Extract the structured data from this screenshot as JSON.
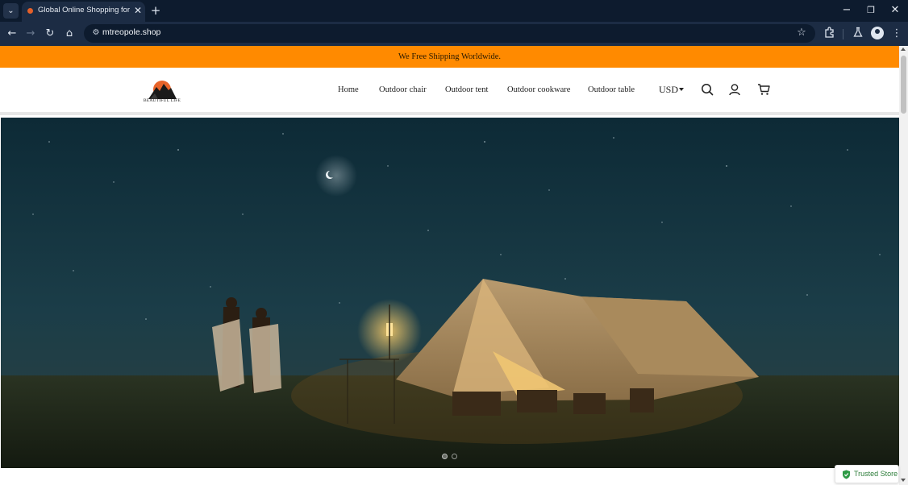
{
  "browser": {
    "tab_menu_icon": "chevron-down",
    "tab": {
      "title": "Global Online Shopping for ,AU",
      "close_glyph": "✕"
    },
    "new_tab_glyph": "+",
    "window": {
      "minimize": "−",
      "restore": "❐",
      "close": "✕"
    },
    "toolbar": {
      "back": "←",
      "forward": "→",
      "reload": "↻",
      "home": "⌂",
      "url": "mtreopole.shop",
      "star": "☆"
    }
  },
  "page": {
    "announcement": "We Free Shipping Worldwide.",
    "logo_text": "BEAUTIFUL LIFE",
    "nav": [
      "Home",
      "Outdoor chair",
      "Outdoor tent",
      "Outdoor cookware",
      "Outdoor table"
    ],
    "currency": "USD",
    "header_icons": [
      "search-icon",
      "account-icon",
      "cart-icon"
    ],
    "hero": {
      "image": "night-camping-tent-scene",
      "slide_count": 2,
      "active_slide": 1
    },
    "trusted_badge": "Trusted Store"
  },
  "colors": {
    "announcement_bg": "#ff8a00",
    "browser_dark": "#0d1b2e",
    "browser_toolbar": "#1c2c44",
    "trusted_green": "#2d7d3a"
  }
}
